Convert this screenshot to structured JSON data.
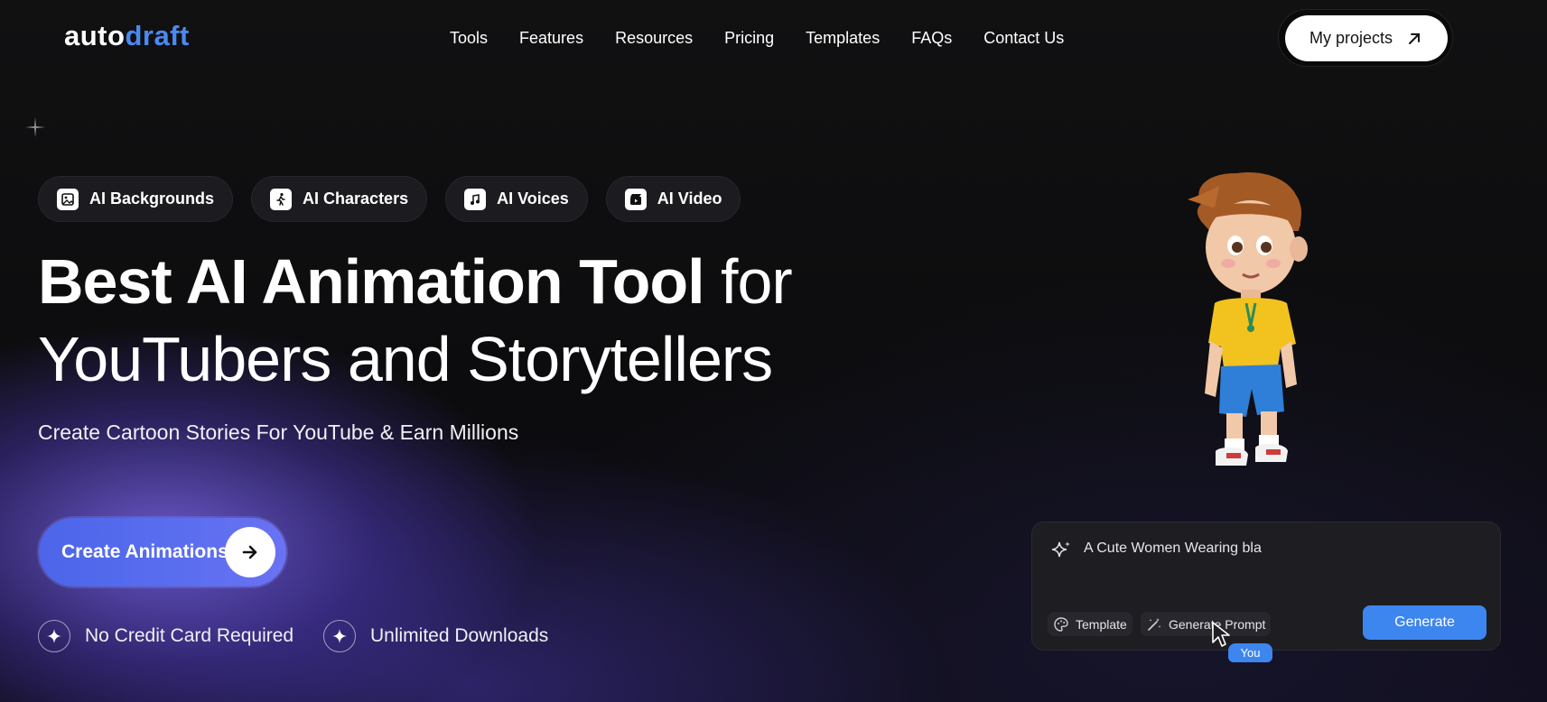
{
  "logo": {
    "part1": "auto",
    "part2": "draft"
  },
  "nav": {
    "items": [
      "Tools",
      "Features",
      "Resources",
      "Pricing",
      "Templates",
      "FAQs",
      "Contact Us"
    ],
    "projects_label": "My projects"
  },
  "pills": [
    {
      "label": "AI Backgrounds",
      "icon": "image-icon"
    },
    {
      "label": "AI Characters",
      "icon": "walking-figure-icon"
    },
    {
      "label": "AI Voices",
      "icon": "music-note-icon"
    },
    {
      "label": "AI Video",
      "icon": "video-clapper-icon"
    }
  ],
  "hero": {
    "title_bold": "Best AI Animation Tool",
    "title_thin": " for",
    "title_line2": "YouTubers and Storytellers",
    "subtitle": "Create Cartoon Stories For YouTube & Earn Millions"
  },
  "cta": {
    "label": "Create Animations"
  },
  "features": [
    "No Credit Card Required",
    "Unlimited Downloads"
  ],
  "prompt_card": {
    "prompt_text": "A Cute Women Wearing bla",
    "template_label": "Template",
    "generate_prompt_label": "Generate Prompt",
    "generate_label": "Generate",
    "cursor_tag": "You"
  },
  "colors": {
    "accent_blue": "#3d86ef",
    "logo_blue": "#4a8af0",
    "cta_gradient_start": "#4c65e9",
    "background": "#0c0c0e"
  }
}
